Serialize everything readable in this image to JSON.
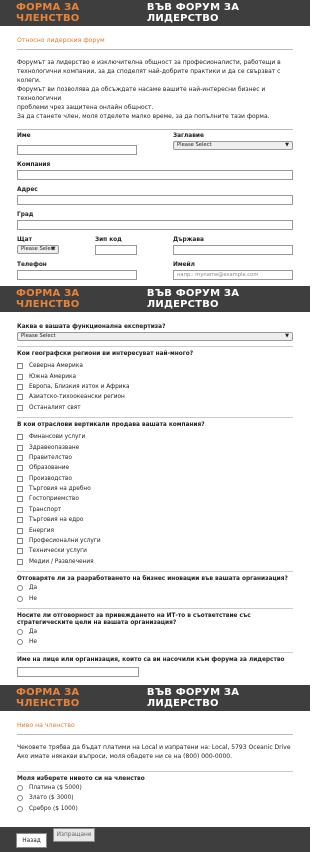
{
  "header": {
    "accent": "ФОРМА ЗА ЧЛЕНСТВО",
    "rest": "ВЪВ ФОРУМ ЗА ЛИДЕРСТВО"
  },
  "section1": {
    "subtitle": "Относно лидерския форум",
    "intro": [
      "Форумът за лидерство е изключителна общност за професионалисти, работещи в",
      "технологични компании, за да споделят най-добрите практики и да се свързват с колеги.",
      "Форумът ви позволява да обсъждате насаме вашите най-интересни бизнес и технологични",
      "проблеми чрез защитена онлайн общност.",
      "За да станете член, моля отделете малко време, за да попълните тази форма."
    ],
    "name_label": "Име",
    "title_label": "Заглавие",
    "title_select": "Please Select",
    "company_label": "Компания",
    "address_label": "Адрес",
    "city_label": "Град",
    "state_label": "Щат",
    "state_select": "Please Select",
    "zip_label": "Зип код",
    "country_label": "Държава",
    "phone_label": "Телефон",
    "email_label": "Имейл",
    "email_placeholder": "напр.: myname@example.com"
  },
  "section2": {
    "q_expertise": "Каква е вашата функционална експертиза?",
    "expertise_select": "Please Select",
    "q_regions": "Кои географски региони ви интересуват най-много?",
    "regions": [
      "Северна Америка",
      "Южна Америка",
      "Европа, Близкия изток и Африка",
      "Азиатско-тихоокеански регион",
      "Останалият свят"
    ],
    "q_verticals": "В кои отраслови вертикали продава вашата компания?",
    "verticals": [
      "Финансови услуги",
      "Здравеопазване",
      "Правителство",
      "Образование",
      "Производство",
      "Търговия на дребно",
      "Гостоприемство",
      "Транспорт",
      "Търговия на едро",
      "Енергия",
      "Професионални услуги",
      "Технически услуги",
      "Медии / Развлечения"
    ],
    "q_innovation": "Отговаряте ли за разработването на бизнес иновации във вашата организация?",
    "innovation_options": [
      "Да",
      "Не"
    ],
    "q_alignment": "Носите ли отговорност за привеждането на ИТ-то в съответствие със стратегическите цели на вашата организация?",
    "alignment_options": [
      "Да",
      "Не"
    ],
    "q_referrer": "Име на лице или организация, които са ви насочили към форума за лидерство"
  },
  "section3": {
    "subtitle": "Ниво на членство",
    "info": [
      "Чековете трябва да бъдат платими на Local и изпратени на: Local, 5793 Oceanic Drive",
      "Ако имате някакви въпроси, моля обадете ни се на (800) 000-0000."
    ],
    "q_level": "Моля изберете нивото си на членство",
    "levels": [
      "Платина ($ 5000)",
      "Злато ($ 3000)",
      "Сребро ($ 1000)"
    ]
  },
  "footer": {
    "back": "Назад",
    "send": "Изпращане"
  }
}
